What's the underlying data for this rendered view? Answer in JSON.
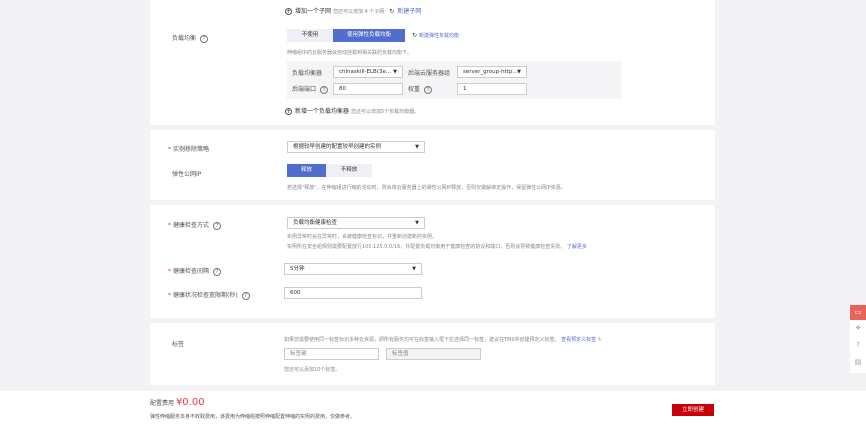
{
  "subnet": {
    "add_label": "增加一个子网",
    "hint": "您还可以增加 4 个子网",
    "new_link": "新建子网"
  },
  "lb": {
    "label": "负载均衡",
    "options": [
      "不使用",
      "使用弹性负载均衡"
    ],
    "selected": 1,
    "new_link": "新建弹性负载均衡",
    "hint": "伸缩组中的云服务器会自动挂载到相关联的负载均衡下。",
    "balancer_label": "负载均衡器",
    "balancer_value": "chinaskill-ELB(3e...",
    "group_label": "后端云服务器组",
    "group_value": "server_group-http...",
    "port_label": "后端端口",
    "port_value": "80",
    "weight_label": "权重",
    "weight_value": "1",
    "add_label": "新增一个负载均衡器",
    "add_hint": "您还可以增加5个负载均衡器。"
  },
  "removal": {
    "label": "实例移除策略",
    "value": "根据较早创建的配置较早创建的实例"
  },
  "eip": {
    "label": "弹性公网IP",
    "options": [
      "释放",
      "不释放"
    ],
    "selected": 0,
    "hint": "若选择\"释放\"，在伸缩组进行缩的活动时，则会将云服务器上的弹性公网IP释放，否则仅做解绑定操作，保留弹性公网IP资源。"
  },
  "health": {
    "method_label": "健康检查方式",
    "method_value": "负载均衡健康检查",
    "hint1": "实例异常时会在异常时，会被健康检查标识，并重新创建新的实例。",
    "hint2": "实例所在安全组规则需要配置放行100.125.0.0/16，并配置负载均衡用于健康检查的协议和端口，否则会导致健康检查失败。",
    "learn_more": "了解更多",
    "interval_label": "健康检查间隔",
    "interval_value": "5分钟",
    "grace_label": "健康状况检查宽限期(秒)",
    "grace_value": "600"
  },
  "tags": {
    "label": "标签",
    "hint": "如果您需要使用同一标签标识多种云资源，即所有服务均可在标签输入框下拉选择同一标签，建议在TMS中创建预定义标签。",
    "view_link": "查看预定义标签",
    "key_placeholder": "标签键",
    "value_placeholder": "标签值",
    "remaining": "您还可以添加10个标签。"
  },
  "footer": {
    "cost_label": "配置费用",
    "cost_value": "¥0.00",
    "note": "弹性伸缩服务本身不收取费用，该费用为伸缩组按照伸缩配置伸缩的实例的费用，仅做参考。",
    "create_button": "立即创建"
  },
  "colors": {
    "accent": "#526ecc",
    "danger": "#c7000b"
  }
}
